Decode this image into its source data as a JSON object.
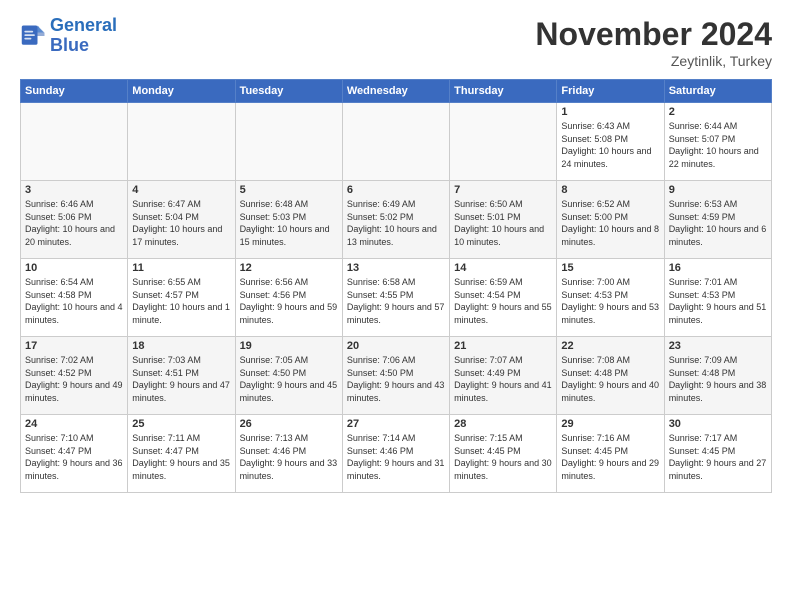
{
  "header": {
    "logo_line1": "General",
    "logo_line2": "Blue",
    "month_title": "November 2024",
    "location": "Zeytinlik, Turkey"
  },
  "days_of_week": [
    "Sunday",
    "Monday",
    "Tuesday",
    "Wednesday",
    "Thursday",
    "Friday",
    "Saturday"
  ],
  "weeks": [
    [
      {
        "day": "",
        "info": ""
      },
      {
        "day": "",
        "info": ""
      },
      {
        "day": "",
        "info": ""
      },
      {
        "day": "",
        "info": ""
      },
      {
        "day": "",
        "info": ""
      },
      {
        "day": "1",
        "info": "Sunrise: 6:43 AM\nSunset: 5:08 PM\nDaylight: 10 hours and 24 minutes."
      },
      {
        "day": "2",
        "info": "Sunrise: 6:44 AM\nSunset: 5:07 PM\nDaylight: 10 hours and 22 minutes."
      }
    ],
    [
      {
        "day": "3",
        "info": "Sunrise: 6:46 AM\nSunset: 5:06 PM\nDaylight: 10 hours and 20 minutes."
      },
      {
        "day": "4",
        "info": "Sunrise: 6:47 AM\nSunset: 5:04 PM\nDaylight: 10 hours and 17 minutes."
      },
      {
        "day": "5",
        "info": "Sunrise: 6:48 AM\nSunset: 5:03 PM\nDaylight: 10 hours and 15 minutes."
      },
      {
        "day": "6",
        "info": "Sunrise: 6:49 AM\nSunset: 5:02 PM\nDaylight: 10 hours and 13 minutes."
      },
      {
        "day": "7",
        "info": "Sunrise: 6:50 AM\nSunset: 5:01 PM\nDaylight: 10 hours and 10 minutes."
      },
      {
        "day": "8",
        "info": "Sunrise: 6:52 AM\nSunset: 5:00 PM\nDaylight: 10 hours and 8 minutes."
      },
      {
        "day": "9",
        "info": "Sunrise: 6:53 AM\nSunset: 4:59 PM\nDaylight: 10 hours and 6 minutes."
      }
    ],
    [
      {
        "day": "10",
        "info": "Sunrise: 6:54 AM\nSunset: 4:58 PM\nDaylight: 10 hours and 4 minutes."
      },
      {
        "day": "11",
        "info": "Sunrise: 6:55 AM\nSunset: 4:57 PM\nDaylight: 10 hours and 1 minute."
      },
      {
        "day": "12",
        "info": "Sunrise: 6:56 AM\nSunset: 4:56 PM\nDaylight: 9 hours and 59 minutes."
      },
      {
        "day": "13",
        "info": "Sunrise: 6:58 AM\nSunset: 4:55 PM\nDaylight: 9 hours and 57 minutes."
      },
      {
        "day": "14",
        "info": "Sunrise: 6:59 AM\nSunset: 4:54 PM\nDaylight: 9 hours and 55 minutes."
      },
      {
        "day": "15",
        "info": "Sunrise: 7:00 AM\nSunset: 4:53 PM\nDaylight: 9 hours and 53 minutes."
      },
      {
        "day": "16",
        "info": "Sunrise: 7:01 AM\nSunset: 4:53 PM\nDaylight: 9 hours and 51 minutes."
      }
    ],
    [
      {
        "day": "17",
        "info": "Sunrise: 7:02 AM\nSunset: 4:52 PM\nDaylight: 9 hours and 49 minutes."
      },
      {
        "day": "18",
        "info": "Sunrise: 7:03 AM\nSunset: 4:51 PM\nDaylight: 9 hours and 47 minutes."
      },
      {
        "day": "19",
        "info": "Sunrise: 7:05 AM\nSunset: 4:50 PM\nDaylight: 9 hours and 45 minutes."
      },
      {
        "day": "20",
        "info": "Sunrise: 7:06 AM\nSunset: 4:50 PM\nDaylight: 9 hours and 43 minutes."
      },
      {
        "day": "21",
        "info": "Sunrise: 7:07 AM\nSunset: 4:49 PM\nDaylight: 9 hours and 41 minutes."
      },
      {
        "day": "22",
        "info": "Sunrise: 7:08 AM\nSunset: 4:48 PM\nDaylight: 9 hours and 40 minutes."
      },
      {
        "day": "23",
        "info": "Sunrise: 7:09 AM\nSunset: 4:48 PM\nDaylight: 9 hours and 38 minutes."
      }
    ],
    [
      {
        "day": "24",
        "info": "Sunrise: 7:10 AM\nSunset: 4:47 PM\nDaylight: 9 hours and 36 minutes."
      },
      {
        "day": "25",
        "info": "Sunrise: 7:11 AM\nSunset: 4:47 PM\nDaylight: 9 hours and 35 minutes."
      },
      {
        "day": "26",
        "info": "Sunrise: 7:13 AM\nSunset: 4:46 PM\nDaylight: 9 hours and 33 minutes."
      },
      {
        "day": "27",
        "info": "Sunrise: 7:14 AM\nSunset: 4:46 PM\nDaylight: 9 hours and 31 minutes."
      },
      {
        "day": "28",
        "info": "Sunrise: 7:15 AM\nSunset: 4:45 PM\nDaylight: 9 hours and 30 minutes."
      },
      {
        "day": "29",
        "info": "Sunrise: 7:16 AM\nSunset: 4:45 PM\nDaylight: 9 hours and 29 minutes."
      },
      {
        "day": "30",
        "info": "Sunrise: 7:17 AM\nSunset: 4:45 PM\nDaylight: 9 hours and 27 minutes."
      }
    ]
  ]
}
